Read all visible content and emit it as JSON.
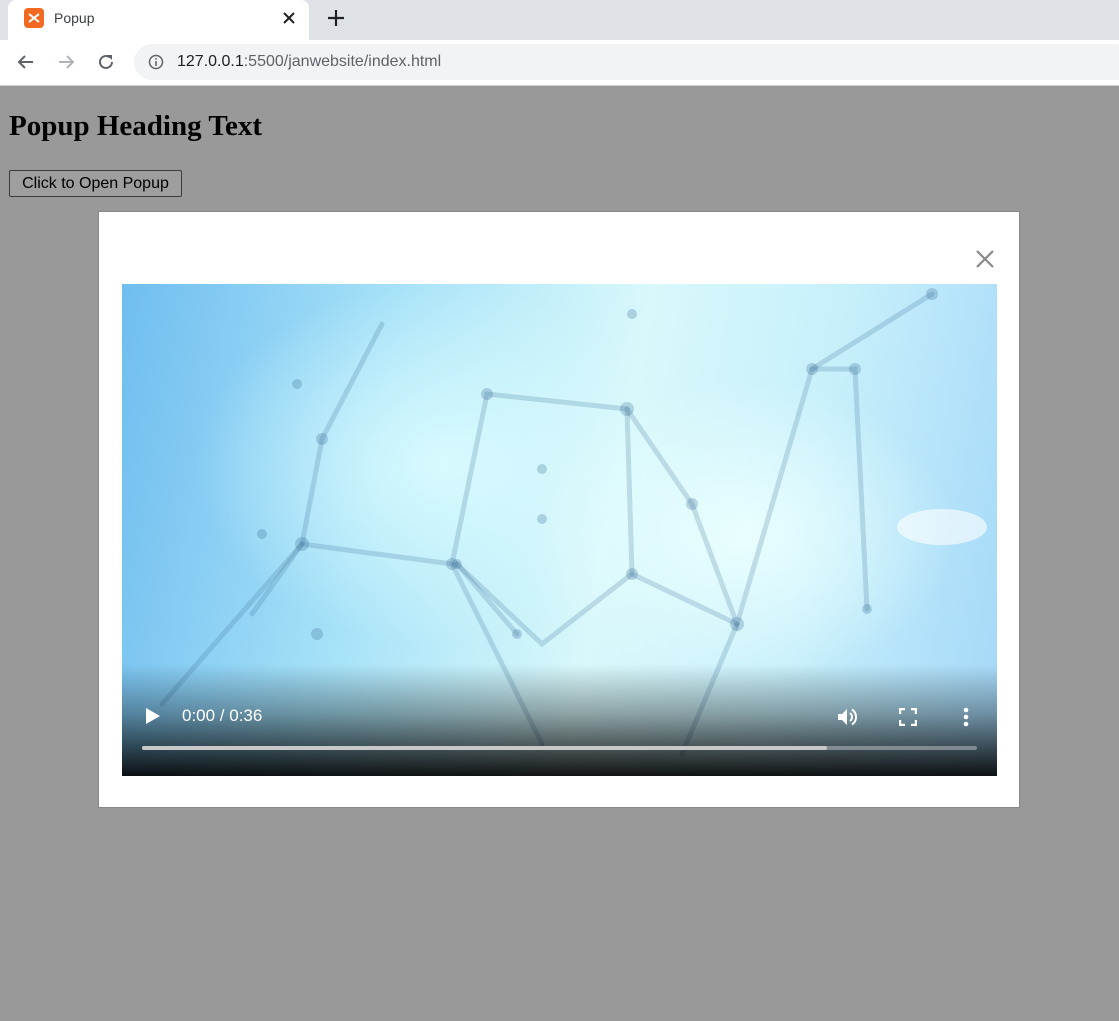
{
  "browser": {
    "tab": {
      "title": "Popup",
      "favicon": "xampp-icon"
    },
    "address": {
      "host": "127.0.0.1",
      "rest": ":5500/janwebsite/index.html"
    }
  },
  "page": {
    "heading": "Popup Heading Text",
    "open_button_label": "Click to Open Popup",
    "background_color": "#999999"
  },
  "popup": {
    "close_icon": "close-icon",
    "video": {
      "time_display": "0:00 / 0:36",
      "current_time": "0:00",
      "duration": "0:36",
      "buffered_fraction": 0.82
    }
  }
}
